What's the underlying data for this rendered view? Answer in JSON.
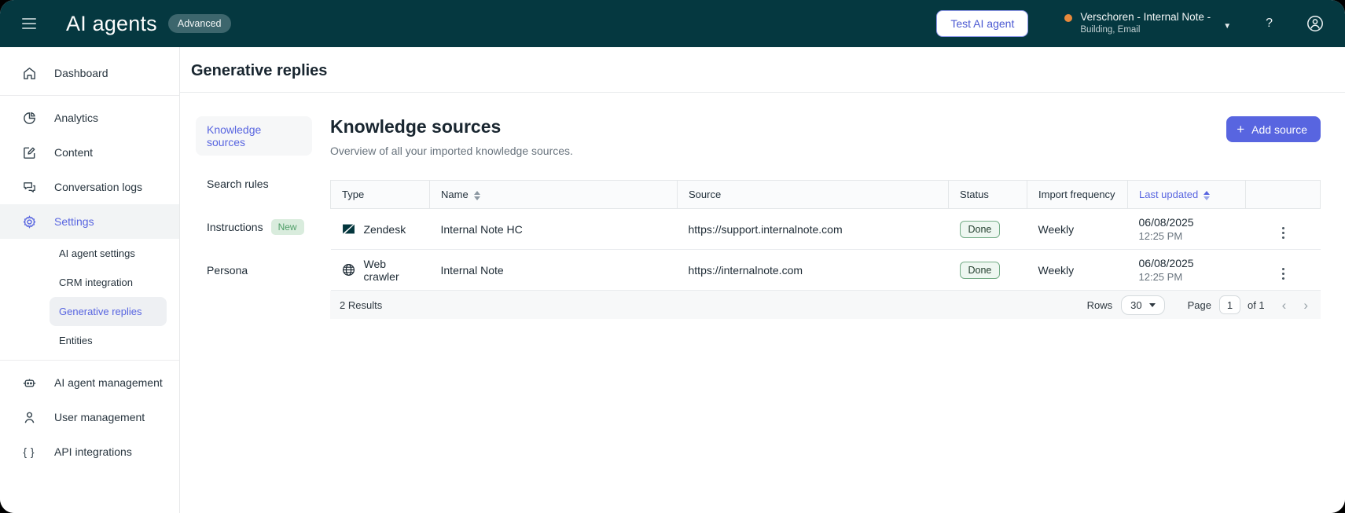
{
  "header": {
    "app_title": "AI agents",
    "plan_badge": "Advanced",
    "test_button_label": "Test AI agent",
    "account": {
      "name": "Verschoren - Internal Note -",
      "detail": "Building, Email"
    },
    "help_label": "?"
  },
  "sidebar": {
    "items": [
      {
        "label": "Dashboard",
        "icon": "home"
      },
      {
        "label": "Analytics",
        "icon": "pie-chart"
      },
      {
        "label": "Content",
        "icon": "edit-square"
      },
      {
        "label": "Conversation logs",
        "icon": "chat-bubbles"
      },
      {
        "label": "Settings",
        "icon": "gear"
      },
      {
        "label": "AI agent management",
        "icon": "robot"
      },
      {
        "label": "User management",
        "icon": "person"
      },
      {
        "label": "API integrations",
        "icon": "braces"
      }
    ],
    "settings_subitems": [
      {
        "label": "AI agent settings"
      },
      {
        "label": "CRM integration"
      },
      {
        "label": "Generative replies"
      },
      {
        "label": "Entities"
      }
    ]
  },
  "page": {
    "title": "Generative replies"
  },
  "subnav": {
    "items": [
      {
        "label": "Knowledge sources"
      },
      {
        "label": "Search rules"
      },
      {
        "label": "Instructions",
        "badge": "New"
      },
      {
        "label": "Persona"
      }
    ]
  },
  "content": {
    "heading": "Knowledge sources",
    "subheading": "Overview of all your imported knowledge sources.",
    "add_button_label": "Add source",
    "add_button_plus": "+"
  },
  "table": {
    "columns": [
      "Type",
      "Name",
      "Source",
      "Status",
      "Import frequency",
      "Last updated"
    ],
    "rows": [
      {
        "type": "Zendesk",
        "type_icon": "zendesk-logo",
        "name": "Internal Note HC",
        "source": "https://support.internalnote.com",
        "status": "Done",
        "frequency": "Weekly",
        "updated_date": "06/08/2025",
        "updated_time": "12:25 PM"
      },
      {
        "type": "Web crawler",
        "type_icon": "globe",
        "name": "Internal Note",
        "source": "https://internalnote.com",
        "status": "Done",
        "frequency": "Weekly",
        "updated_date": "06/08/2025",
        "updated_time": "12:25 PM"
      }
    ],
    "footer": {
      "results": "2 Results",
      "rows_label": "Rows",
      "rows_value": "30",
      "page_label": "Page",
      "page_value": "1",
      "of_label": "of 1",
      "prev": "‹",
      "next": "›"
    }
  },
  "colors": {
    "topbar_bg": "#053840",
    "accent_indigo": "#5865e0",
    "org_dot_orange": "#e8893c",
    "done_badge_border": "#74ac86",
    "done_badge_bg": "#eef7f1",
    "new_badge_bg": "#d9ecdd",
    "new_badge_text": "#4f9e68",
    "footer_bg": "#f7f8f9"
  }
}
